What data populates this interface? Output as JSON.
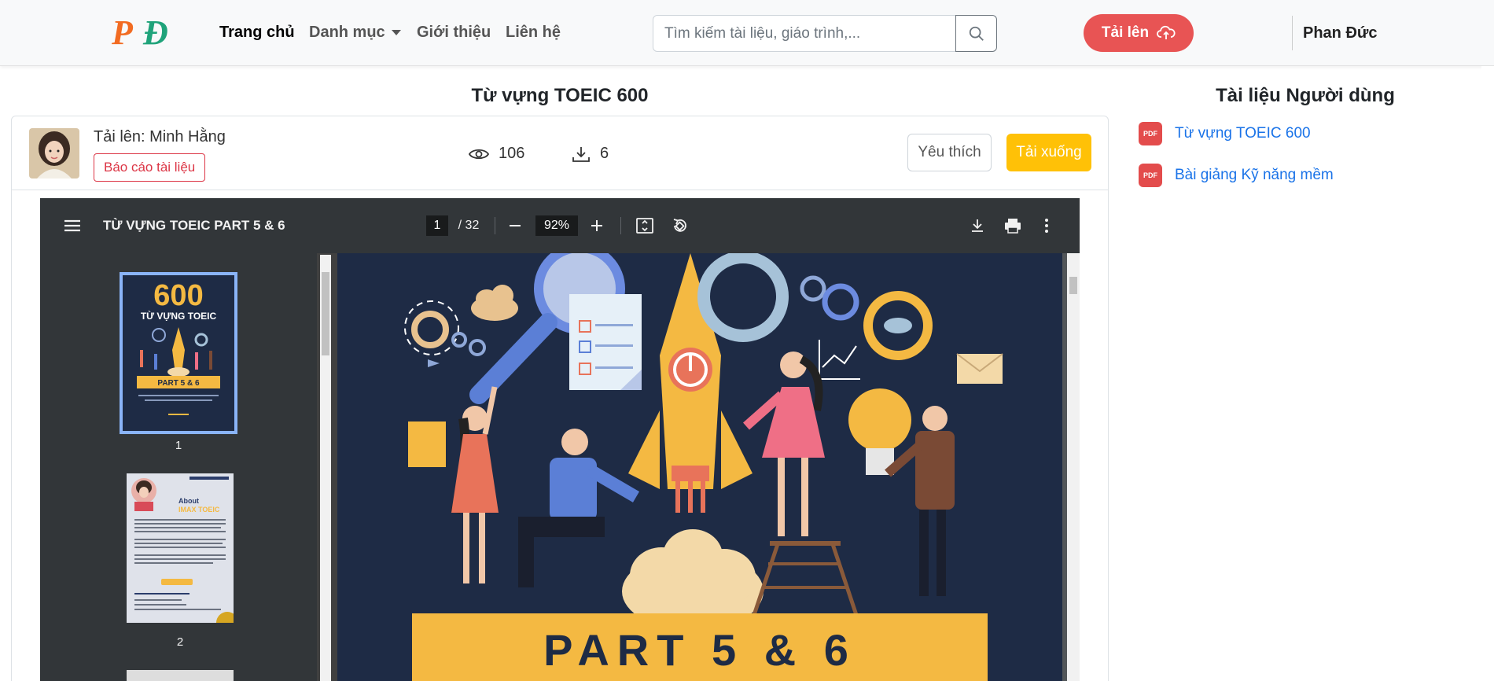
{
  "nav": {
    "logo_text": "PĐ",
    "links": [
      "Trang chủ",
      "Danh mục",
      "Giới thiệu",
      "Liên hệ"
    ],
    "search_placeholder": "Tìm kiếm tài liệu, giáo trình,...",
    "upload_label": "Tải lên",
    "username": "Phan Đức"
  },
  "document": {
    "title": "Từ vựng TOEIC 600",
    "uploader": "Tải lên: Minh Hằng",
    "report_label": "Báo cáo tài liệu",
    "views": "106",
    "downloads": "6",
    "favorite_label": "Yêu thích",
    "download_label": "Tải xuống"
  },
  "viewer": {
    "file_title": "TỪ VỰNG TOEIC PART 5 & 6",
    "current_page": "1",
    "total_pages": "/ 32",
    "zoom": "92%",
    "thumbnails": [
      {
        "page": "1",
        "title_big": "600",
        "title_small": "TỪ VỰNG TOEIC",
        "banner": "PART 5 & 6"
      },
      {
        "page": "2",
        "heading": "About",
        "heading2": "IMAX TOEIC"
      }
    ],
    "page_banner": "PART 5 & 6"
  },
  "sidebar": {
    "title": "Tài liệu Người dùng",
    "items": [
      {
        "badge": "PDF",
        "label": "Từ vựng TOEIC 600"
      },
      {
        "badge": "PDF",
        "label": "Bài giảng Kỹ năng mềm"
      }
    ]
  },
  "colors": {
    "accent_red": "#e85454",
    "download_yellow": "#ffc107",
    "link_blue": "#1a73e8",
    "poster_bg": "#1e2b45",
    "poster_yellow": "#f4b942"
  }
}
